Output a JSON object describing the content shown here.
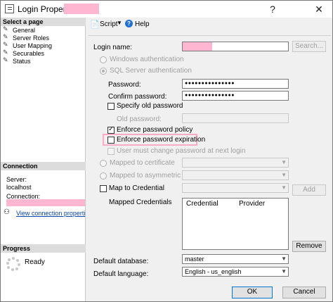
{
  "window": {
    "title": "Login Properties",
    "controls": {
      "help": "?",
      "close": "✕"
    }
  },
  "left_panel": {
    "select_page_header": "Select a page",
    "pages": [
      {
        "label": "General"
      },
      {
        "label": "Server Roles"
      },
      {
        "label": "User Mapping"
      },
      {
        "label": "Securables"
      },
      {
        "label": "Status"
      }
    ],
    "connection_header": "Connection",
    "server_label": "Server:",
    "server_value": "localhost",
    "connection_label": "Connection:",
    "view_connection_link": "View connection properties",
    "progress_header": "Progress",
    "progress_status": "Ready"
  },
  "toolbar": {
    "script_label": "Script",
    "help_label": "Help"
  },
  "form": {
    "login_name_label": "Login name:",
    "search_button": "Search...",
    "windows_auth_label": "Windows authentication",
    "sql_auth_label": "SQL Server authentication",
    "password_label": "Password:",
    "password_value": "●●●●●●●●●●●●●●●",
    "confirm_password_label": "Confirm password:",
    "confirm_password_value": "●●●●●●●●●●●●●●●",
    "specify_old_password_label": "Specify old password",
    "old_password_label": "Old password:",
    "enforce_policy_label": "Enforce password policy",
    "enforce_expiration_label": "Enforce password expiration",
    "must_change_label": "User must change password at next login",
    "mapped_cert_label": "Mapped to certificate",
    "mapped_asym_key_label": "Mapped to asymmetric key",
    "map_credential_label": "Map to Credential",
    "add_button": "Add",
    "mapped_credentials_label": "Mapped Credentials",
    "grid_columns": [
      "Credential",
      "Provider"
    ],
    "remove_button": "Remove",
    "default_database_label": "Default database:",
    "default_database_value": "master",
    "default_language_label": "Default language:",
    "default_language_value": "English - us_english"
  },
  "footer": {
    "ok_button": "OK",
    "cancel_button": "Cancel"
  }
}
